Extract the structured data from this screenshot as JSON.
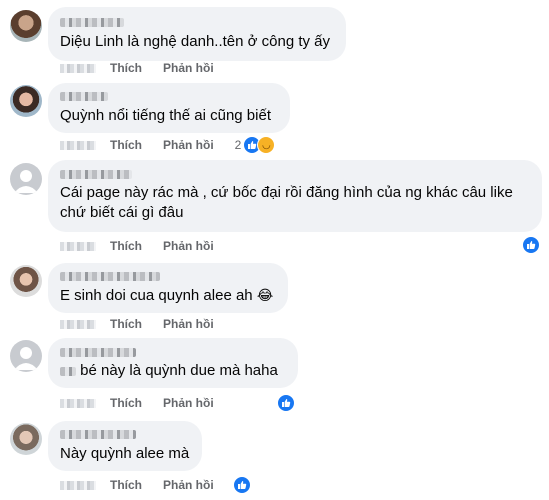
{
  "actions": {
    "like": "Thích",
    "reply": "Phản hồi"
  },
  "colors": {
    "like_blue": "#1877f2",
    "haha_yellow": "#f7b125",
    "bubble": "#f0f2f5",
    "meta_gray": "#65676b"
  },
  "comments": [
    {
      "text": "Diệu Linh là nghệ danh..tên ở công ty ấy"
    },
    {
      "text": "Quỳnh nổi tiếng thế ai cũng biết",
      "reaction_count": "2",
      "reactions": [
        "like-icon",
        "haha-icon"
      ]
    },
    {
      "text_line1": "Cái page này rác mà , cứ bốc đại rồi đăng hình của ng khác câu like",
      "text_line2": "chứ biết cái gì đâu",
      "reactions": [
        "like-icon"
      ]
    },
    {
      "text": "E sinh doi cua quynh alee ah",
      "emoji": "😂"
    },
    {
      "text": "bé này là quỳnh due mà haha",
      "reactions": [
        "like-icon"
      ]
    },
    {
      "text": "Này quỳnh alee mà",
      "reactions": [
        "like-icon"
      ]
    }
  ]
}
